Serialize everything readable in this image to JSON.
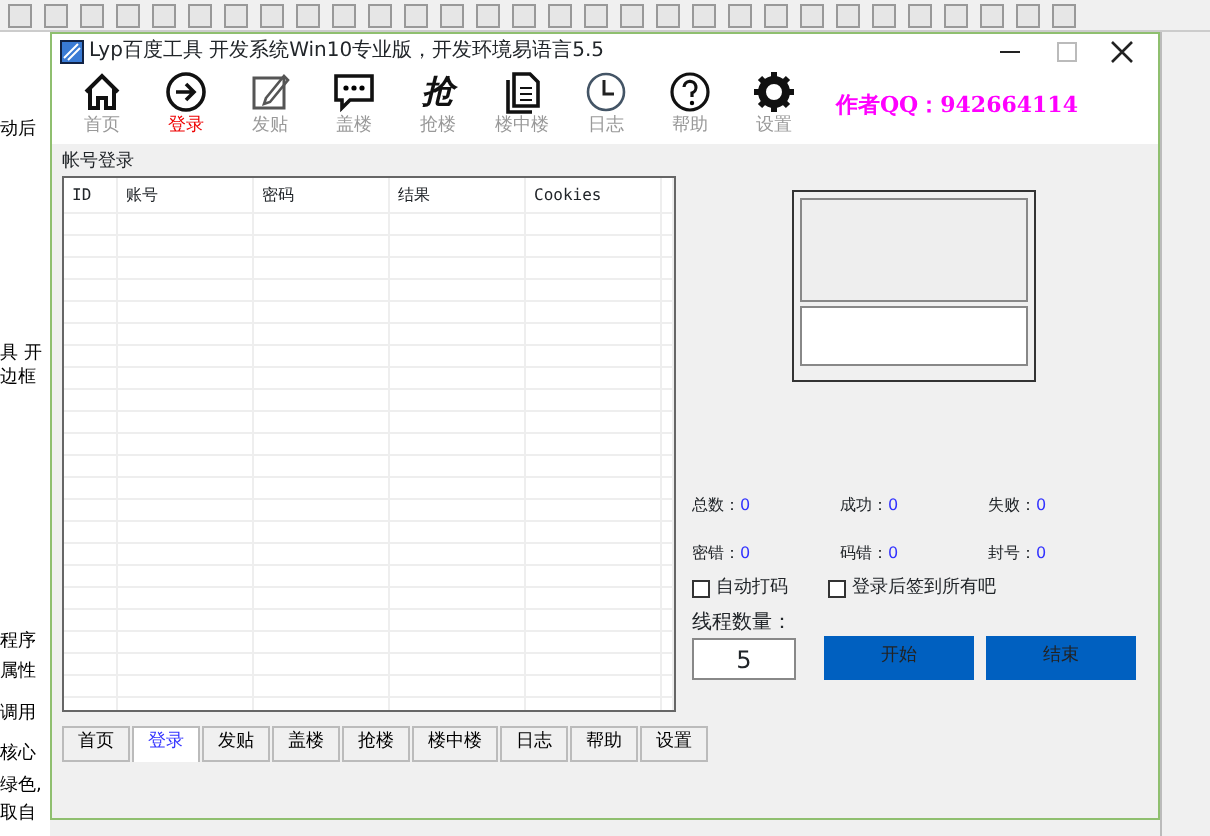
{
  "background_ide": {
    "fragments": [
      "动后",
      "具 开",
      "边框",
      "程序",
      "属性",
      "调用",
      "核心",
      "绿色,",
      "取自"
    ]
  },
  "window": {
    "title": "Lyp百度工具 开发系统Win10专业版，开发环境易语言5.5"
  },
  "toolbar": [
    {
      "kind": "home",
      "label": "首页",
      "selected": false
    },
    {
      "kind": "login",
      "label": "登录",
      "selected": true
    },
    {
      "kind": "post",
      "label": "发贴",
      "selected": false
    },
    {
      "kind": "reply",
      "label": "盖楼",
      "selected": false
    },
    {
      "kind": "grab",
      "glyph": "抢",
      "label": "抢楼",
      "selected": false
    },
    {
      "kind": "floor",
      "label": "楼中楼",
      "selected": false
    },
    {
      "kind": "log",
      "label": "日志",
      "selected": false
    },
    {
      "kind": "help",
      "label": "帮助",
      "selected": false
    },
    {
      "kind": "settings",
      "label": "设置",
      "selected": false
    }
  ],
  "author": "作者QQ：942664114",
  "account_group": {
    "title": "帐号登录",
    "table": {
      "columns": [
        "ID",
        "账号",
        "密码",
        "结果",
        "Cookies"
      ]
    }
  },
  "stats": [
    {
      "label": "总数：",
      "value": "0"
    },
    {
      "label": "成功：",
      "value": "0"
    },
    {
      "label": "失败：",
      "value": "0"
    },
    {
      "label": "密错：",
      "value": "0"
    },
    {
      "label": "码错：",
      "value": "0"
    },
    {
      "label": "封号：",
      "value": "0"
    }
  ],
  "options": [
    {
      "label": "自动打码",
      "checked": false
    },
    {
      "label": "登录后签到所有吧",
      "checked": false
    }
  ],
  "threads": {
    "label": "线程数量：",
    "value": "5"
  },
  "buttons": [
    "开始",
    "结束"
  ],
  "tabs": [
    {
      "label": "首页",
      "selected": false
    },
    {
      "label": "登录",
      "selected": true
    },
    {
      "label": "发贴",
      "selected": false
    },
    {
      "label": "盖楼",
      "selected": false
    },
    {
      "label": "抢楼",
      "selected": false
    },
    {
      "label": "楼中楼",
      "selected": false
    },
    {
      "label": "日志",
      "selected": false
    },
    {
      "label": "帮助",
      "selected": false
    },
    {
      "label": "设置",
      "selected": false
    }
  ]
}
